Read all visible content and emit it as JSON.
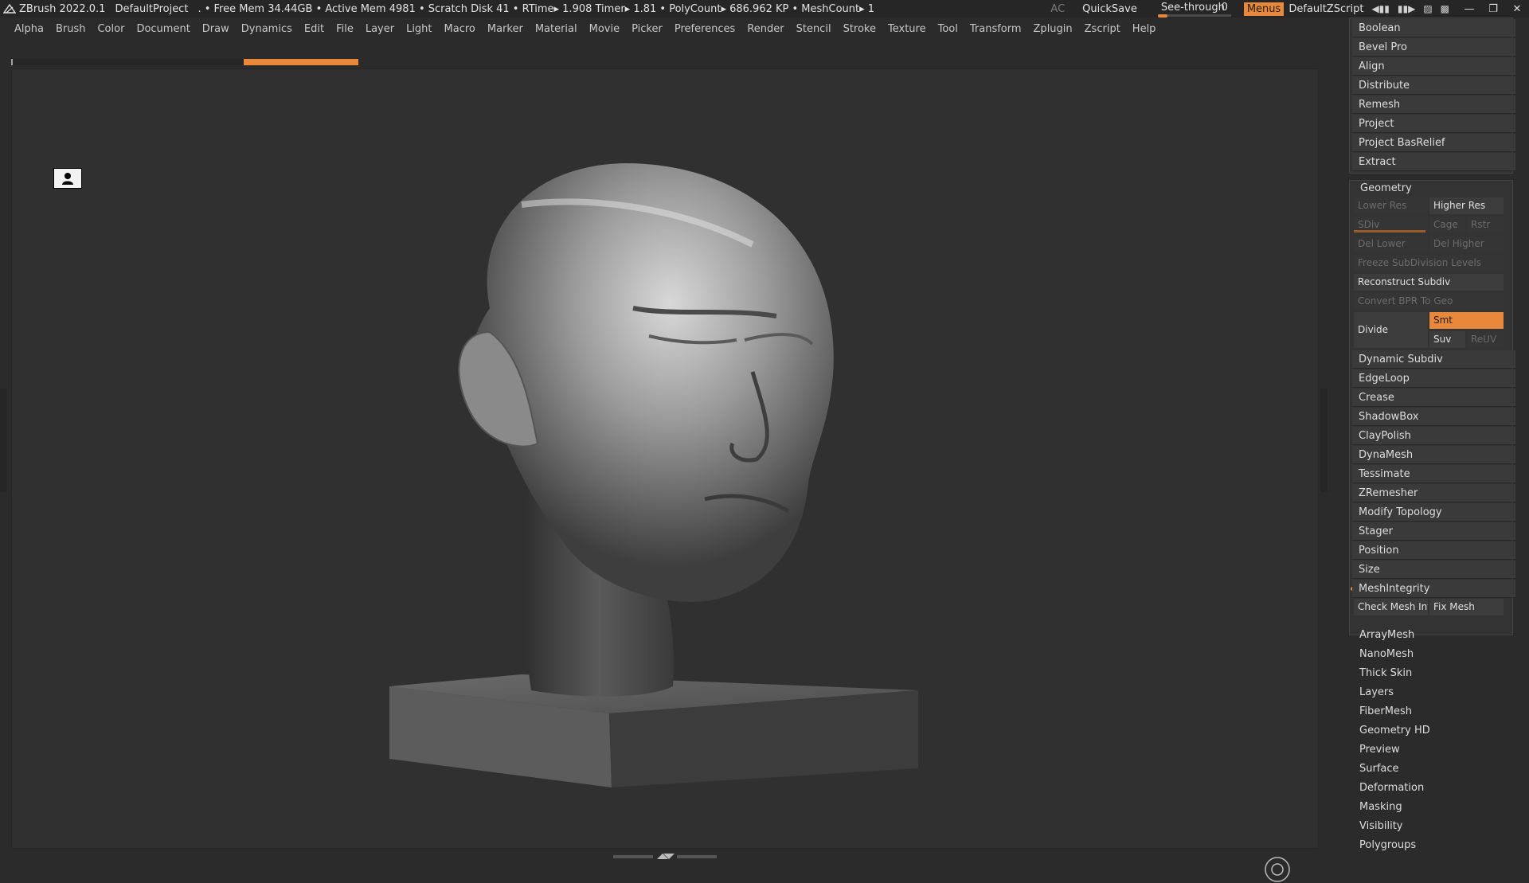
{
  "titlebar": {
    "app": "ZBrush 2022.0.1",
    "project": "DefaultProject",
    "stats": ". • Free Mem 34.44GB • Active Mem 4981 • Scratch Disk 41 •  RTime▸ 1.908 Timer▸ 1.81 • PolyCount▸ 686.962 KP  • MeshCount▸ 1",
    "ac": "AC",
    "quicksave": "QuickSave",
    "see_through_label": "See-through",
    "see_through_value": "0",
    "see_through_level": 0,
    "menus": "Menus",
    "default_zscript": "DefaultZScript",
    "accent_color": "#e8883a"
  },
  "menubar": [
    "Alpha",
    "Brush",
    "Color",
    "Document",
    "Draw",
    "Dynamics",
    "Edit",
    "File",
    "Layer",
    "Light",
    "Macro",
    "Marker",
    "Material",
    "Movie",
    "Picker",
    "Preferences",
    "Render",
    "Stencil",
    "Stroke",
    "Texture",
    "Tool",
    "Transform",
    "Zplugin",
    "Zscript",
    "Help"
  ],
  "top_tools": [
    "Boolean",
    "Bevel Pro",
    "Align",
    "Distribute",
    "Remesh",
    "Project",
    "Project BasRelief",
    "Extract"
  ],
  "geometry": {
    "title": "Geometry",
    "lower_res": "Lower Res",
    "higher_res": "Higher Res",
    "sdiv": "SDiv",
    "cage": "Cage",
    "rstr": "Rstr",
    "del_lower": "Del Lower",
    "del_higher": "Del Higher",
    "freeze": "Freeze SubDivision Levels",
    "reconstruct": "Reconstruct Subdiv",
    "convert_bpr": "Convert BPR To Geo",
    "divide": "Divide",
    "smt": "Smt",
    "suv": "Suv",
    "reuv": "ReUV",
    "items": [
      "Dynamic Subdiv",
      "EdgeLoop",
      "Crease",
      "ShadowBox",
      "ClayPolish",
      "DynaMesh",
      "Tessimate",
      "ZRemesher",
      "Modify Topology",
      "Stager",
      "Position",
      "Size"
    ],
    "mesh_integrity": "MeshIntegrity",
    "check_mesh": "Check Mesh Integrity",
    "fix_mesh": "Fix Mesh"
  },
  "subpalettes": [
    "ArrayMesh",
    "NanoMesh",
    "Thick Skin",
    "Layers",
    "FiberMesh",
    "Geometry HD",
    "Preview",
    "Surface",
    "Deformation",
    "Masking",
    "Visibility",
    "Polygroups"
  ]
}
